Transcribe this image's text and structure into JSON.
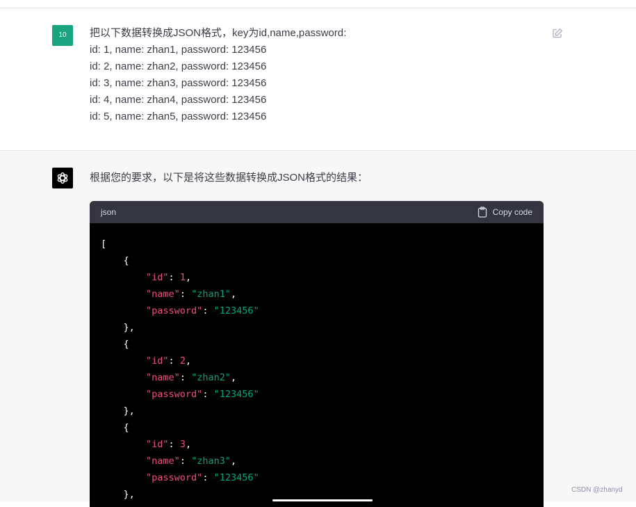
{
  "user": {
    "avatar_text": "10",
    "lines": [
      "把以下数据转换成JSON格式，key为id,name,password:",
      "id: 1, name: zhan1, password: 123456",
      "id: 2, name: zhan2, password: 123456",
      "id: 3, name: zhan3, password: 123456",
      "id: 4, name: zhan4, password: 123456",
      "id: 5, name: zhan5, password: 123456"
    ],
    "edit_icon": "pencil-edit-icon"
  },
  "assistant": {
    "avatar_icon": "openai-logo-icon",
    "intro": "根据您的要求，以下是将这些数据转换成JSON格式的结果：",
    "code": {
      "language": "json",
      "copy_label": "Copy code",
      "copy_icon": "clipboard-icon",
      "lines": [
        [
          {
            "t": "p",
            "v": "["
          }
        ],
        [
          {
            "t": "p",
            "v": "    {"
          }
        ],
        [
          {
            "t": "p",
            "v": "        "
          },
          {
            "t": "k",
            "v": "\"id\""
          },
          {
            "t": "p",
            "v": ": "
          },
          {
            "t": "n",
            "v": "1"
          },
          {
            "t": "p",
            "v": ","
          }
        ],
        [
          {
            "t": "p",
            "v": "        "
          },
          {
            "t": "k",
            "v": "\"name\""
          },
          {
            "t": "p",
            "v": ": "
          },
          {
            "t": "s",
            "v": "\"zhan1\""
          },
          {
            "t": "p",
            "v": ","
          }
        ],
        [
          {
            "t": "p",
            "v": "        "
          },
          {
            "t": "k",
            "v": "\"password\""
          },
          {
            "t": "p",
            "v": ": "
          },
          {
            "t": "s",
            "v": "\"123456\""
          }
        ],
        [
          {
            "t": "p",
            "v": "    },"
          }
        ],
        [
          {
            "t": "p",
            "v": "    {"
          }
        ],
        [
          {
            "t": "p",
            "v": "        "
          },
          {
            "t": "k",
            "v": "\"id\""
          },
          {
            "t": "p",
            "v": ": "
          },
          {
            "t": "n",
            "v": "2"
          },
          {
            "t": "p",
            "v": ","
          }
        ],
        [
          {
            "t": "p",
            "v": "        "
          },
          {
            "t": "k",
            "v": "\"name\""
          },
          {
            "t": "p",
            "v": ": "
          },
          {
            "t": "s",
            "v": "\"zhan2\""
          },
          {
            "t": "p",
            "v": ","
          }
        ],
        [
          {
            "t": "p",
            "v": "        "
          },
          {
            "t": "k",
            "v": "\"password\""
          },
          {
            "t": "p",
            "v": ": "
          },
          {
            "t": "s",
            "v": "\"123456\""
          }
        ],
        [
          {
            "t": "p",
            "v": "    },"
          }
        ],
        [
          {
            "t": "p",
            "v": "    {"
          }
        ],
        [
          {
            "t": "p",
            "v": "        "
          },
          {
            "t": "k",
            "v": "\"id\""
          },
          {
            "t": "p",
            "v": ": "
          },
          {
            "t": "n",
            "v": "3"
          },
          {
            "t": "p",
            "v": ","
          }
        ],
        [
          {
            "t": "p",
            "v": "        "
          },
          {
            "t": "k",
            "v": "\"name\""
          },
          {
            "t": "p",
            "v": ": "
          },
          {
            "t": "s",
            "v": "\"zhan3\""
          },
          {
            "t": "p",
            "v": ","
          }
        ],
        [
          {
            "t": "p",
            "v": "        "
          },
          {
            "t": "k",
            "v": "\"password\""
          },
          {
            "t": "p",
            "v": ": "
          },
          {
            "t": "s",
            "v": "\"123456\""
          }
        ],
        [
          {
            "t": "p",
            "v": "    },"
          }
        ]
      ]
    }
  },
  "watermark": "CSDN @zhanyd",
  "colors": {
    "user_avatar": "#19a37f",
    "code_header": "#343541",
    "code_bg": "#000000",
    "json_key": "#ef4e7b",
    "json_number": "#ef4e7b",
    "json_string": "#00a67d",
    "assistant_bg": "#f7f7f8"
  }
}
